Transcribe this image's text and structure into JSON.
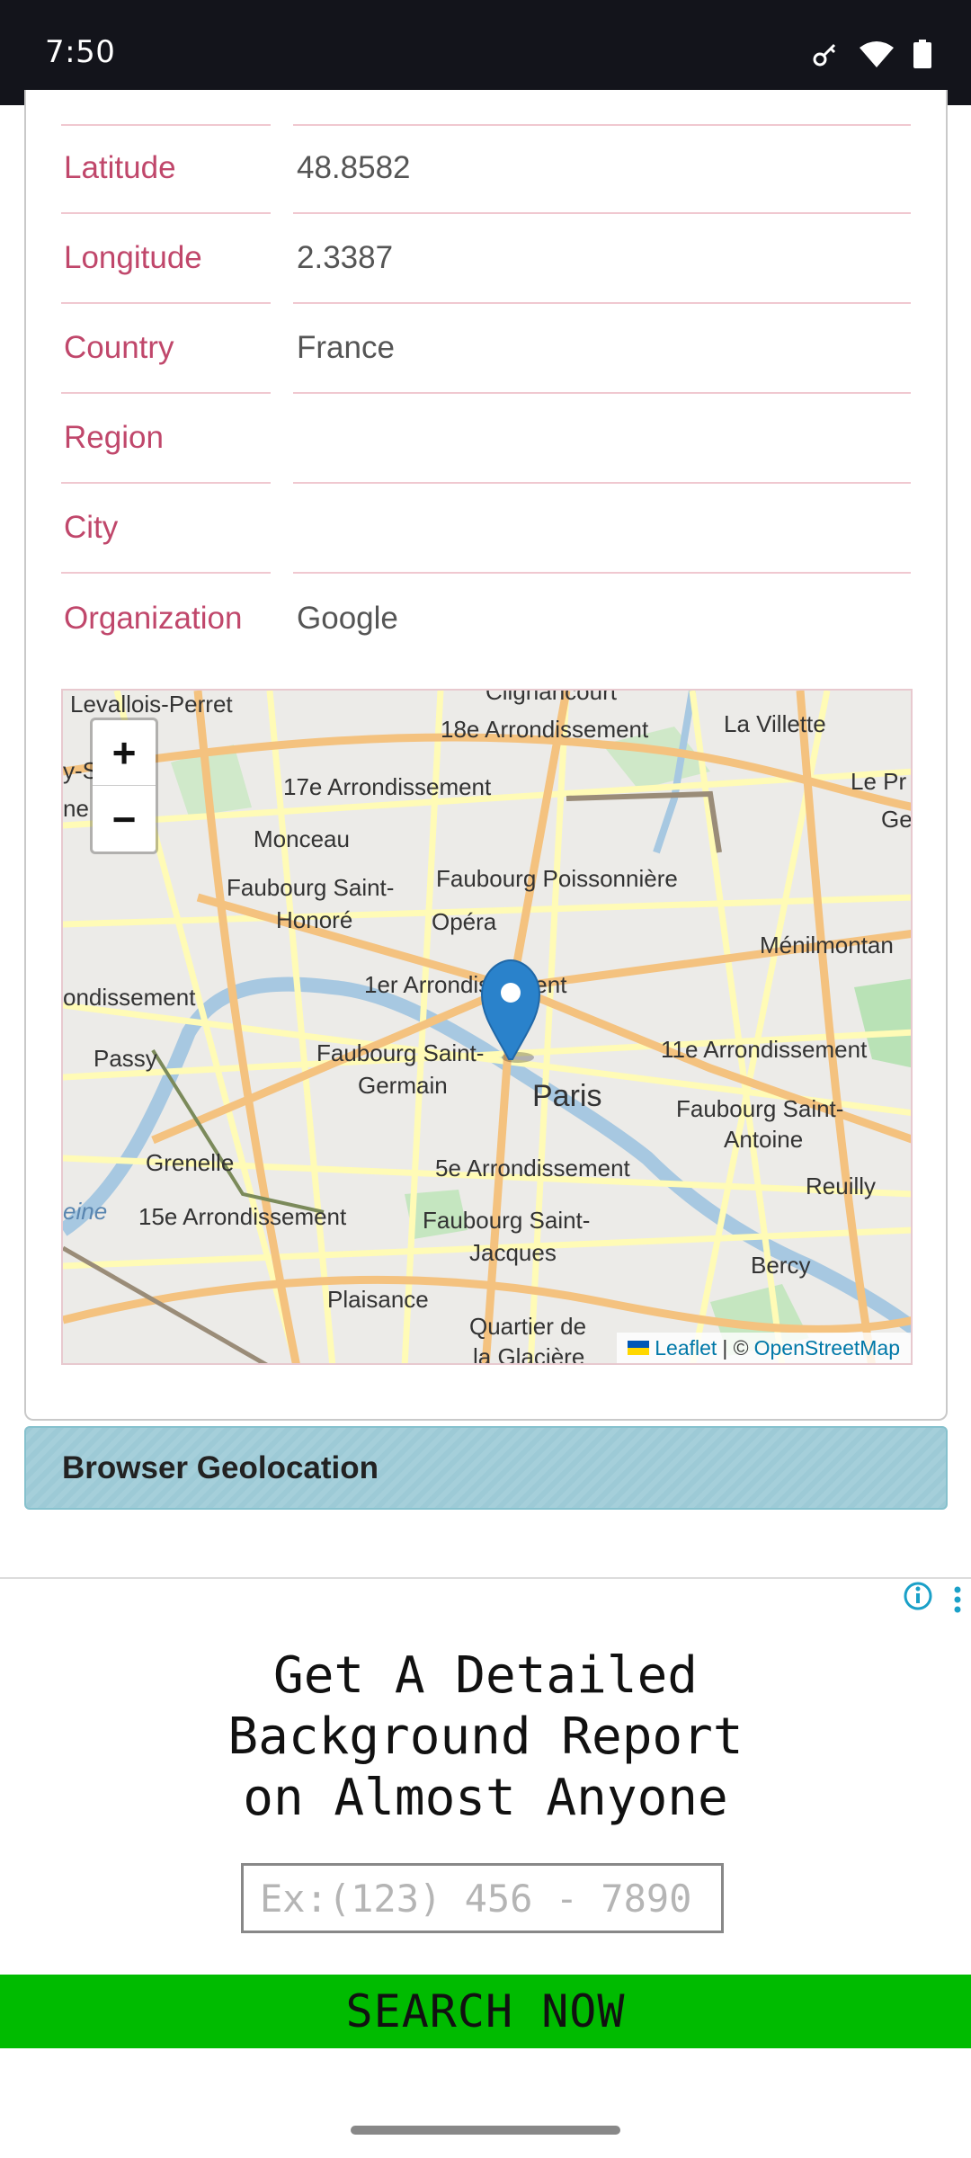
{
  "status_bar": {
    "time": "7:50"
  },
  "location_table": [
    {
      "label": "Latitude",
      "value": "48.8582"
    },
    {
      "label": "Longitude",
      "value": "2.3387"
    },
    {
      "label": "Country",
      "value": "France"
    },
    {
      "label": "Region",
      "value": ""
    },
    {
      "label": "City",
      "value": ""
    },
    {
      "label": "Organization",
      "value": "Google"
    }
  ],
  "map": {
    "zoom_in": "+",
    "zoom_out": "−",
    "labels": [
      "Levallois-Perret",
      "Clignancourt",
      "18e Arrondissement",
      "La Villette",
      "17e Arrondissement",
      "Le Pr",
      "Ge",
      "y-S",
      "ne",
      "Monceau",
      "Faubourg Poissonnière",
      "Faubourg Saint-",
      "Honoré",
      "Opéra",
      "Ménilmontan",
      "1er Arrondissement",
      "ondissement",
      "Passy",
      "Faubourg Saint-",
      "Germain",
      "11e Arrondissement",
      "Paris",
      "Faubourg Saint-",
      "Antoine",
      "Grenelle",
      "5e Arrondissement",
      "Reuilly",
      "eine",
      "15e Arrondissement",
      "Faubourg Saint-",
      "Jacques",
      "Bercy",
      "Plaisance",
      "Quartier de",
      "la Glacière"
    ],
    "attribution_leaflet": "Leaflet",
    "attribution_sep": "| ©",
    "attribution_osm": "OpenStreetMap",
    "colors": {
      "road_major": "#f4c27f",
      "road_minor": "#fffbb6",
      "water": "#a7c8e1",
      "park": "#b9e2b6",
      "marker": "#2a82cb"
    }
  },
  "geolocation_section": {
    "title": "Browser Geolocation"
  },
  "ad": {
    "title_lines": [
      "Get A Detailed",
      "Background Report",
      "on Almost Anyone"
    ],
    "input_placeholder": "Ex:(123) 456 - 7890",
    "button_label": "SEARCH NOW",
    "button_color": "#00bb00"
  }
}
